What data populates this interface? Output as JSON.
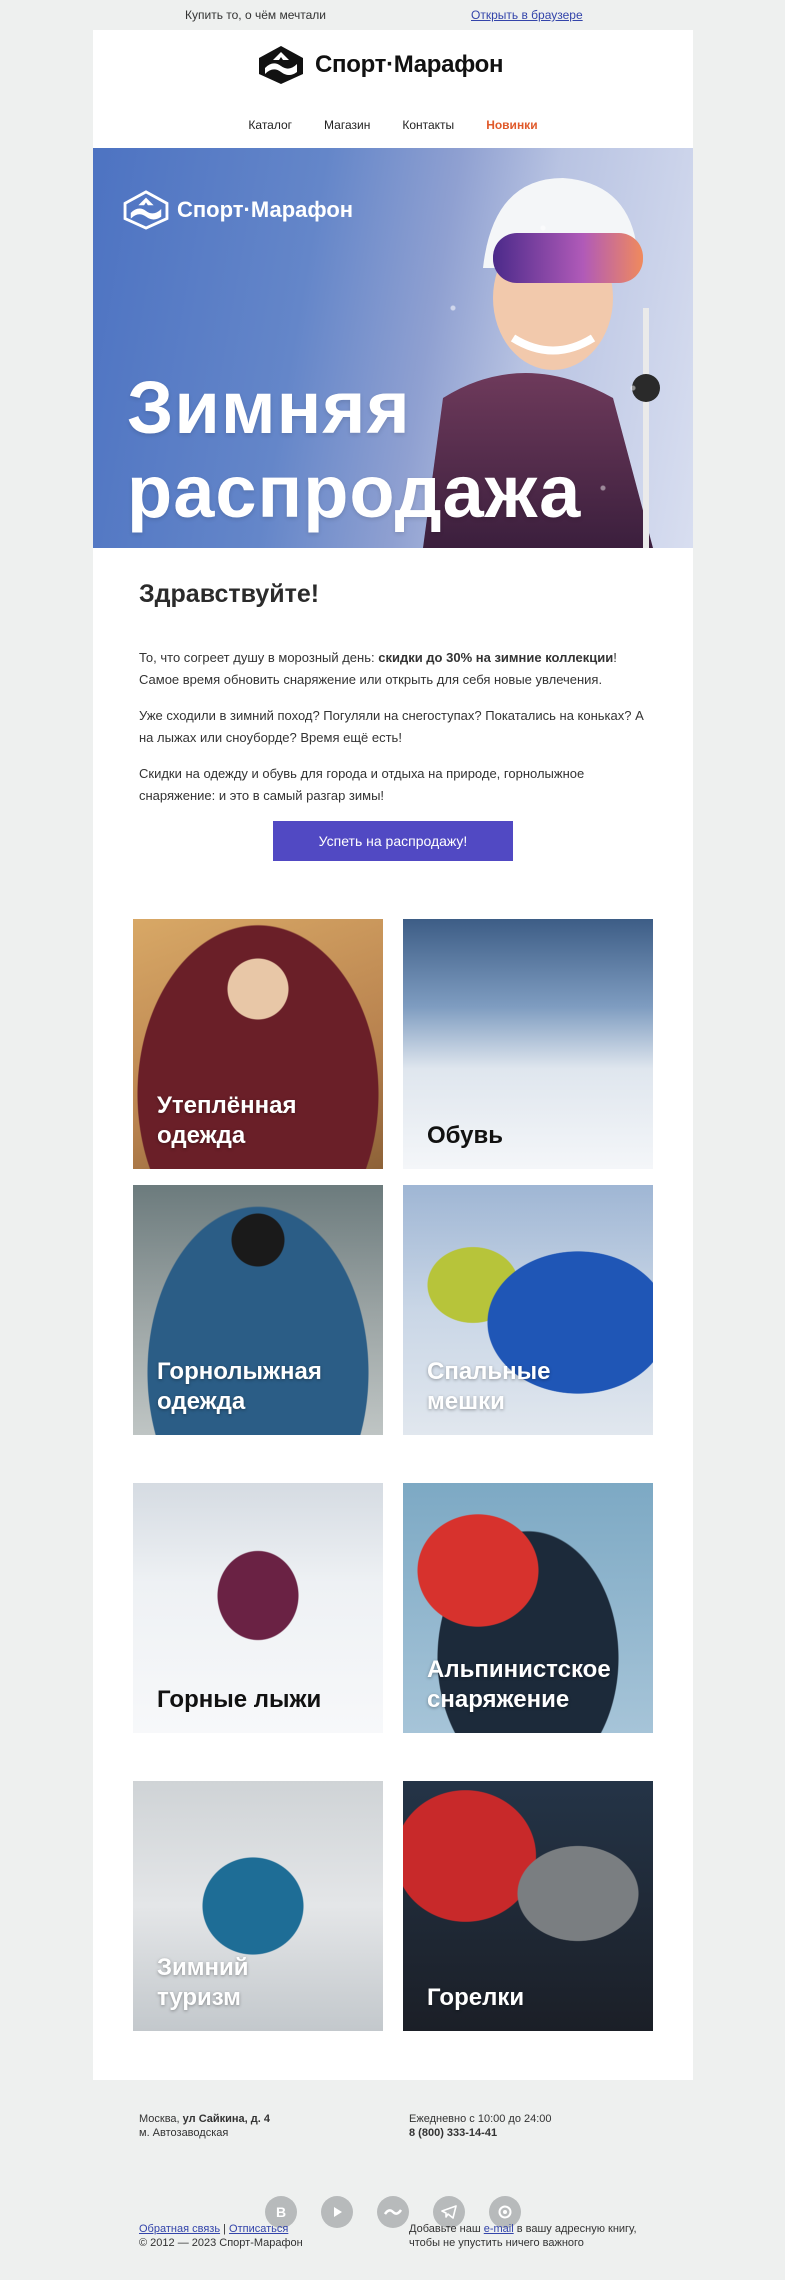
{
  "preheader": {
    "tagline": "Купить то, о чём мечтали",
    "browser_link": "Открыть в браузере"
  },
  "brand": {
    "name": "Спорт·Марафон"
  },
  "nav": {
    "items": [
      "Каталог",
      "Магазин",
      "Контакты",
      "Новинки"
    ],
    "accent_color": "#e05a2b"
  },
  "hero": {
    "title_line1": "Зимняя",
    "title_line2": "распродажа"
  },
  "content": {
    "greeting": "Здравствуйте!",
    "p1_before": "То, что согреет душу в морозный день: ",
    "p1_bold": "скидки до 30% на зимние коллекции",
    "p1_after": "! Самое время обновить снаряжение или открыть для себя новые увлечения.",
    "p2": "Уже сходили в зимний поход? Погуляли на снегоступах? Покатались на коньках? А на лыжах или сноуборде? Время ещё есть!",
    "p3": "Скидки на одежду и обувь для города и отдыха на природе, горнолыжное снаряжение: и это в самый разгар зимы!",
    "cta": "Успеть на распродажу!",
    "cta_color": "#5149c3"
  },
  "tiles": [
    {
      "line1": "Утеплённая",
      "line2": "одежда"
    },
    {
      "line1": "Обувь",
      "line2": ""
    },
    {
      "line1": "Горнолыжная",
      "line2": "одежда"
    },
    {
      "line1": "Спальные",
      "line2": "мешки"
    },
    {
      "line1": "Горные лыжи",
      "line2": ""
    },
    {
      "line1": "Альпинистское",
      "line2": "снаряжение"
    },
    {
      "line1": "Зимний",
      "line2": "туризм"
    },
    {
      "line1": "Горелки",
      "line2": ""
    }
  ],
  "footer": {
    "city": "Москва, ",
    "street": "ул Сайкина, д. 4",
    "metro": "м. Автозаводская",
    "hours": "Ежедневно с 10:00 до 24:00",
    "phone": "8 (800) 333-14-41",
    "feedback": "Обратная связь",
    "separator": " | ",
    "unsubscribe": "Отписаться",
    "copyright": "© 2012 — 2023 Спорт-Марафон",
    "add_before": "Добавьте наш ",
    "add_link": "e-mail",
    "add_after": " в вашу адресную книгу, чтобы не упустить ничего важного",
    "socials": [
      "vk-icon",
      "youtube-icon",
      "wave-icon",
      "telegram-icon",
      "ok-icon"
    ],
    "social_vk_glyph": "В"
  }
}
